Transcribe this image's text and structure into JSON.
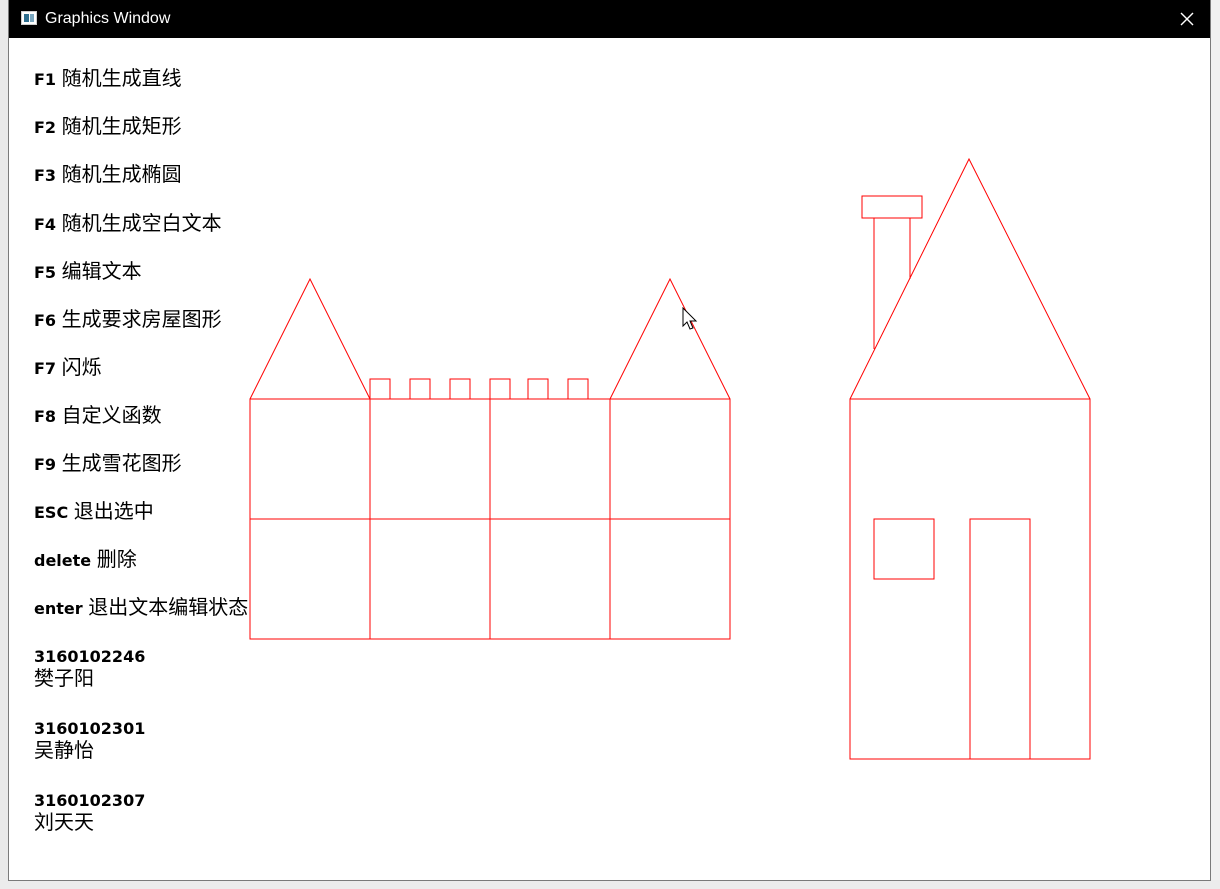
{
  "window": {
    "title": "Graphics Window"
  },
  "menu": [
    {
      "key": "F1",
      "label": "随机生成直线"
    },
    {
      "key": "F2",
      "label": "随机生成矩形"
    },
    {
      "key": "F3",
      "label": "随机生成椭圆"
    },
    {
      "key": "F4",
      "label": "随机生成空白文本"
    },
    {
      "key": "F5",
      "label": "编辑文本"
    },
    {
      "key": "F6",
      "label": "生成要求房屋图形"
    },
    {
      "key": "F7",
      "label": "闪烁"
    },
    {
      "key": "F8",
      "label": "自定义函数"
    },
    {
      "key": "F9",
      "label": "生成雪花图形"
    },
    {
      "key": "ESC",
      "label": "退出选中"
    },
    {
      "key": "delete",
      "label": "删除"
    },
    {
      "key": "enter",
      "label": "退出文本编辑状态"
    }
  ],
  "students": [
    {
      "id": "3160102246",
      "name": "樊子阳"
    },
    {
      "id": "3160102301",
      "name": "吴静怡"
    },
    {
      "id": "3160102307",
      "name": "刘天天"
    }
  ],
  "drawing": {
    "stroke_color": "#ff0000"
  },
  "icons": {
    "close": "close-icon",
    "app": "app-icon",
    "cursor": "mouse-cursor-icon"
  }
}
